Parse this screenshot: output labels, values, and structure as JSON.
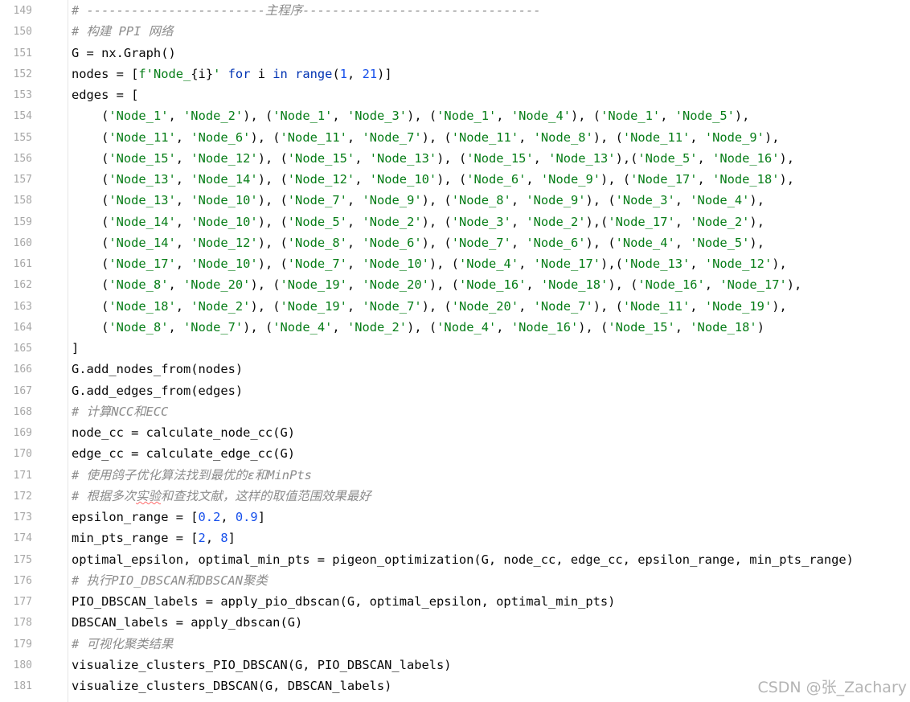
{
  "colors": {
    "string": "#067d17",
    "number": "#1750eb",
    "keyword": "#0033b3",
    "comment": "#8c8c8c",
    "plain": "#080808",
    "line_number": "#a7a7a7"
  },
  "watermark": "CSDN @张_Zachary",
  "lines": [
    {
      "n": "149",
      "tokens": [
        [
          "c",
          "# ------------------------主程序--------------------------------"
        ]
      ]
    },
    {
      "n": "150",
      "tokens": [
        [
          "c",
          "# 构建 PPI 网络"
        ]
      ]
    },
    {
      "n": "151",
      "tokens": [
        [
          "p",
          "G = nx.Graph()"
        ]
      ]
    },
    {
      "n": "152",
      "tokens": [
        [
          "p",
          "nodes = ["
        ],
        [
          "s",
          "f'Node_"
        ],
        [
          "p",
          "{i}"
        ],
        [
          "s",
          "'"
        ],
        [
          "p",
          " "
        ],
        [
          "k",
          "for"
        ],
        [
          "p",
          " i "
        ],
        [
          "k",
          "in"
        ],
        [
          "p",
          " "
        ],
        [
          "k",
          "range"
        ],
        [
          "p",
          "("
        ],
        [
          "n",
          "1"
        ],
        [
          "p",
          ", "
        ],
        [
          "n",
          "21"
        ],
        [
          "p",
          ")]"
        ]
      ]
    },
    {
      "n": "153",
      "tokens": [
        [
          "p",
          "edges = ["
        ]
      ]
    },
    {
      "n": "154",
      "tokens": [
        [
          "p",
          "    ("
        ],
        [
          "s",
          "'Node_1'"
        ],
        [
          "p",
          ", "
        ],
        [
          "s",
          "'Node_2'"
        ],
        [
          "p",
          "), ("
        ],
        [
          "s",
          "'Node_1'"
        ],
        [
          "p",
          ", "
        ],
        [
          "s",
          "'Node_3'"
        ],
        [
          "p",
          "), ("
        ],
        [
          "s",
          "'Node_1'"
        ],
        [
          "p",
          ", "
        ],
        [
          "s",
          "'Node_4'"
        ],
        [
          "p",
          "), ("
        ],
        [
          "s",
          "'Node_1'"
        ],
        [
          "p",
          ", "
        ],
        [
          "s",
          "'Node_5'"
        ],
        [
          "p",
          "),"
        ]
      ]
    },
    {
      "n": "155",
      "tokens": [
        [
          "p",
          "    ("
        ],
        [
          "s",
          "'Node_11'"
        ],
        [
          "p",
          ", "
        ],
        [
          "s",
          "'Node_6'"
        ],
        [
          "p",
          "), ("
        ],
        [
          "s",
          "'Node_11'"
        ],
        [
          "p",
          ", "
        ],
        [
          "s",
          "'Node_7'"
        ],
        [
          "p",
          "), ("
        ],
        [
          "s",
          "'Node_11'"
        ],
        [
          "p",
          ", "
        ],
        [
          "s",
          "'Node_8'"
        ],
        [
          "p",
          "), ("
        ],
        [
          "s",
          "'Node_11'"
        ],
        [
          "p",
          ", "
        ],
        [
          "s",
          "'Node_9'"
        ],
        [
          "p",
          "),"
        ]
      ]
    },
    {
      "n": "156",
      "tokens": [
        [
          "p",
          "    ("
        ],
        [
          "s",
          "'Node_15'"
        ],
        [
          "p",
          ", "
        ],
        [
          "s",
          "'Node_12'"
        ],
        [
          "p",
          "), ("
        ],
        [
          "s",
          "'Node_15'"
        ],
        [
          "p",
          ", "
        ],
        [
          "s",
          "'Node_13'"
        ],
        [
          "p",
          "), ("
        ],
        [
          "s",
          "'Node_15'"
        ],
        [
          "p",
          ", "
        ],
        [
          "s",
          "'Node_13'"
        ],
        [
          "p",
          "),("
        ],
        [
          "s",
          "'Node_5'"
        ],
        [
          "p",
          ", "
        ],
        [
          "s",
          "'Node_16'"
        ],
        [
          "p",
          "),"
        ]
      ]
    },
    {
      "n": "157",
      "tokens": [
        [
          "p",
          "    ("
        ],
        [
          "s",
          "'Node_13'"
        ],
        [
          "p",
          ", "
        ],
        [
          "s",
          "'Node_14'"
        ],
        [
          "p",
          "), ("
        ],
        [
          "s",
          "'Node_12'"
        ],
        [
          "p",
          ", "
        ],
        [
          "s",
          "'Node_10'"
        ],
        [
          "p",
          "), ("
        ],
        [
          "s",
          "'Node_6'"
        ],
        [
          "p",
          ", "
        ],
        [
          "s",
          "'Node_9'"
        ],
        [
          "p",
          "), ("
        ],
        [
          "s",
          "'Node_17'"
        ],
        [
          "p",
          ", "
        ],
        [
          "s",
          "'Node_18'"
        ],
        [
          "p",
          "),"
        ]
      ]
    },
    {
      "n": "158",
      "tokens": [
        [
          "p",
          "    ("
        ],
        [
          "s",
          "'Node_13'"
        ],
        [
          "p",
          ", "
        ],
        [
          "s",
          "'Node_10'"
        ],
        [
          "p",
          "), ("
        ],
        [
          "s",
          "'Node_7'"
        ],
        [
          "p",
          ", "
        ],
        [
          "s",
          "'Node_9'"
        ],
        [
          "p",
          "), ("
        ],
        [
          "s",
          "'Node_8'"
        ],
        [
          "p",
          ", "
        ],
        [
          "s",
          "'Node_9'"
        ],
        [
          "p",
          "), ("
        ],
        [
          "s",
          "'Node_3'"
        ],
        [
          "p",
          ", "
        ],
        [
          "s",
          "'Node_4'"
        ],
        [
          "p",
          "),"
        ]
      ]
    },
    {
      "n": "159",
      "tokens": [
        [
          "p",
          "    ("
        ],
        [
          "s",
          "'Node_14'"
        ],
        [
          "p",
          ", "
        ],
        [
          "s",
          "'Node_10'"
        ],
        [
          "p",
          "), ("
        ],
        [
          "s",
          "'Node_5'"
        ],
        [
          "p",
          ", "
        ],
        [
          "s",
          "'Node_2'"
        ],
        [
          "p",
          "), ("
        ],
        [
          "s",
          "'Node_3'"
        ],
        [
          "p",
          ", "
        ],
        [
          "s",
          "'Node_2'"
        ],
        [
          "p",
          "),("
        ],
        [
          "s",
          "'Node_17'"
        ],
        [
          "p",
          ", "
        ],
        [
          "s",
          "'Node_2'"
        ],
        [
          "p",
          "),"
        ]
      ]
    },
    {
      "n": "160",
      "tokens": [
        [
          "p",
          "    ("
        ],
        [
          "s",
          "'Node_14'"
        ],
        [
          "p",
          ", "
        ],
        [
          "s",
          "'Node_12'"
        ],
        [
          "p",
          "), ("
        ],
        [
          "s",
          "'Node_8'"
        ],
        [
          "p",
          ", "
        ],
        [
          "s",
          "'Node_6'"
        ],
        [
          "p",
          "), ("
        ],
        [
          "s",
          "'Node_7'"
        ],
        [
          "p",
          ", "
        ],
        [
          "s",
          "'Node_6'"
        ],
        [
          "p",
          "), ("
        ],
        [
          "s",
          "'Node_4'"
        ],
        [
          "p",
          ", "
        ],
        [
          "s",
          "'Node_5'"
        ],
        [
          "p",
          "),"
        ]
      ]
    },
    {
      "n": "161",
      "tokens": [
        [
          "p",
          "    ("
        ],
        [
          "s",
          "'Node_17'"
        ],
        [
          "p",
          ", "
        ],
        [
          "s",
          "'Node_10'"
        ],
        [
          "p",
          "), ("
        ],
        [
          "s",
          "'Node_7'"
        ],
        [
          "p",
          ", "
        ],
        [
          "s",
          "'Node_10'"
        ],
        [
          "p",
          "), ("
        ],
        [
          "s",
          "'Node_4'"
        ],
        [
          "p",
          ", "
        ],
        [
          "s",
          "'Node_17'"
        ],
        [
          "p",
          "),("
        ],
        [
          "s",
          "'Node_13'"
        ],
        [
          "p",
          ", "
        ],
        [
          "s",
          "'Node_12'"
        ],
        [
          "p",
          "),"
        ]
      ]
    },
    {
      "n": "162",
      "tokens": [
        [
          "p",
          "    ("
        ],
        [
          "s",
          "'Node_8'"
        ],
        [
          "p",
          ", "
        ],
        [
          "s",
          "'Node_20'"
        ],
        [
          "p",
          "), ("
        ],
        [
          "s",
          "'Node_19'"
        ],
        [
          "p",
          ", "
        ],
        [
          "s",
          "'Node_20'"
        ],
        [
          "p",
          "), ("
        ],
        [
          "s",
          "'Node_16'"
        ],
        [
          "p",
          ", "
        ],
        [
          "s",
          "'Node_18'"
        ],
        [
          "p",
          "), ("
        ],
        [
          "s",
          "'Node_16'"
        ],
        [
          "p",
          ", "
        ],
        [
          "s",
          "'Node_17'"
        ],
        [
          "p",
          "),"
        ]
      ]
    },
    {
      "n": "163",
      "tokens": [
        [
          "p",
          "    ("
        ],
        [
          "s",
          "'Node_18'"
        ],
        [
          "p",
          ", "
        ],
        [
          "s",
          "'Node_2'"
        ],
        [
          "p",
          "), ("
        ],
        [
          "s",
          "'Node_19'"
        ],
        [
          "p",
          ", "
        ],
        [
          "s",
          "'Node_7'"
        ],
        [
          "p",
          "), ("
        ],
        [
          "s",
          "'Node_20'"
        ],
        [
          "p",
          ", "
        ],
        [
          "s",
          "'Node_7'"
        ],
        [
          "p",
          "), ("
        ],
        [
          "s",
          "'Node_11'"
        ],
        [
          "p",
          ", "
        ],
        [
          "s",
          "'Node_19'"
        ],
        [
          "p",
          "),"
        ]
      ]
    },
    {
      "n": "164",
      "tokens": [
        [
          "p",
          "    ("
        ],
        [
          "s",
          "'Node_8'"
        ],
        [
          "p",
          ", "
        ],
        [
          "s",
          "'Node_7'"
        ],
        [
          "p",
          "), ("
        ],
        [
          "s",
          "'Node_4'"
        ],
        [
          "p",
          ", "
        ],
        [
          "s",
          "'Node_2'"
        ],
        [
          "p",
          "), ("
        ],
        [
          "s",
          "'Node_4'"
        ],
        [
          "p",
          ", "
        ],
        [
          "s",
          "'Node_16'"
        ],
        [
          "p",
          "), ("
        ],
        [
          "s",
          "'Node_15'"
        ],
        [
          "p",
          ", "
        ],
        [
          "s",
          "'Node_18'"
        ],
        [
          "p",
          ")"
        ]
      ]
    },
    {
      "n": "165",
      "tokens": [
        [
          "p",
          "]"
        ]
      ]
    },
    {
      "n": "166",
      "tokens": [
        [
          "p",
          "G.add_nodes_from(nodes)"
        ]
      ]
    },
    {
      "n": "167",
      "tokens": [
        [
          "p",
          "G.add_edges_from(edges)"
        ]
      ]
    },
    {
      "n": "168",
      "tokens": [
        [
          "c",
          "# 计算NCC和ECC"
        ]
      ]
    },
    {
      "n": "169",
      "tokens": [
        [
          "p",
          "node_cc = calculate_node_cc(G)"
        ]
      ]
    },
    {
      "n": "170",
      "tokens": [
        [
          "p",
          "edge_cc = calculate_edge_cc(G)"
        ]
      ]
    },
    {
      "n": "171",
      "tokens": [
        [
          "c",
          "# 使用鸽子优化算法找到最优的ε和MinPts"
        ]
      ]
    },
    {
      "n": "172",
      "tokens": [
        [
          "c",
          "# 根据多次"
        ],
        [
          "ci",
          "实验"
        ],
        [
          "c",
          "和查找文献，这样的取值范围效果最好"
        ]
      ]
    },
    {
      "n": "173",
      "tokens": [
        [
          "p",
          "epsilon_range = ["
        ],
        [
          "n",
          "0.2"
        ],
        [
          "p",
          ", "
        ],
        [
          "n",
          "0.9"
        ],
        [
          "p",
          "]"
        ]
      ]
    },
    {
      "n": "174",
      "tokens": [
        [
          "p",
          "min_pts_range = ["
        ],
        [
          "n",
          "2"
        ],
        [
          "p",
          ", "
        ],
        [
          "n",
          "8"
        ],
        [
          "p",
          "]"
        ]
      ]
    },
    {
      "n": "175",
      "tokens": [
        [
          "p",
          "optimal_epsilon, optimal_min_pts = pigeon_optimization(G, node_cc, edge_cc, epsilon_range, min_pts_range)"
        ]
      ]
    },
    {
      "n": "176",
      "tokens": [
        [
          "c",
          "# 执行PIO_DBSCAN和DBSCAN聚类"
        ]
      ]
    },
    {
      "n": "177",
      "tokens": [
        [
          "p",
          "PIO_DBSCAN_labels = apply_pio_dbscan(G, optimal_epsilon, optimal_min_pts)"
        ]
      ]
    },
    {
      "n": "178",
      "tokens": [
        [
          "p",
          "DBSCAN_labels = apply_dbscan(G)"
        ]
      ]
    },
    {
      "n": "179",
      "tokens": [
        [
          "c",
          "# 可视化聚类结果"
        ]
      ]
    },
    {
      "n": "180",
      "tokens": [
        [
          "p",
          "visualize_clusters_PIO_DBSCAN(G, PIO_DBSCAN_labels)"
        ]
      ]
    },
    {
      "n": "181",
      "tokens": [
        [
          "p",
          "visualize_clusters_DBSCAN(G, DBSCAN_labels)"
        ]
      ]
    }
  ]
}
